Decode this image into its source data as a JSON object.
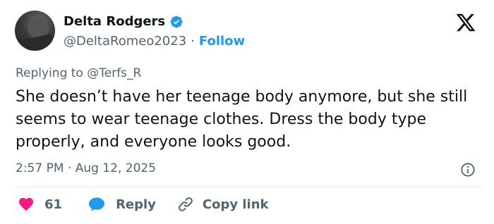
{
  "author": {
    "name": "Delta Rodgers",
    "handle": "@DeltaRomeo2023",
    "separator": "·",
    "follow_label": "Follow"
  },
  "reply_to": "Replying to @Terfs_R",
  "tweet": {
    "text": "She doesn’t have her teenage body anymore, but she still seems to wear teenage clothes. Dress the body type properly, and everyone looks good.",
    "timestamp": "2:57 PM · Aug 12, 2025"
  },
  "actions": {
    "likes": "61",
    "reply_label": "Reply",
    "copy_link_label": "Copy link"
  },
  "colors": {
    "accent": "#1d9bf0",
    "like": "#f91880",
    "secondary_text": "#536471",
    "primary_text": "#0f1419"
  },
  "icons": [
    "verified-badge-icon",
    "x-logo-icon",
    "info-icon",
    "heart-icon",
    "reply-bubble-icon",
    "link-icon"
  ]
}
